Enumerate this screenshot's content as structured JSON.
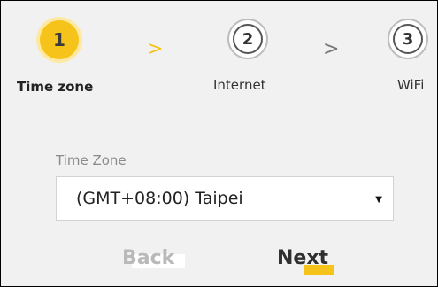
{
  "steps": [
    {
      "number": "1",
      "label": "Time zone"
    },
    {
      "number": "2",
      "label": "Internet"
    },
    {
      "number": "3",
      "label": "WiFi"
    }
  ],
  "separators": [
    ">",
    ">"
  ],
  "form": {
    "time_zone_label": "Time Zone",
    "time_zone_value": "(GMT+08:00) Taipei",
    "caret": "▼"
  },
  "buttons": {
    "back_label": "Back",
    "next_label": "Next"
  },
  "colors": {
    "accent": "#f6c31a",
    "accent_halo": "#fde9a3",
    "active_arrow": "#f6c31a",
    "idle_arrow": "#777777"
  }
}
